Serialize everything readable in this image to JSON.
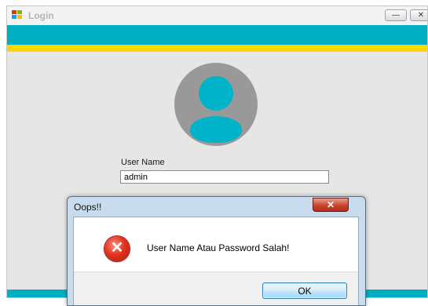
{
  "window": {
    "title": "Login",
    "minimize_glyph": "—",
    "close_glyph": "✕"
  },
  "form": {
    "username_label": "User Name",
    "username_value": "admin"
  },
  "dialog": {
    "title": "Oops!!",
    "close_glyph": "✕",
    "icon": "error-icon",
    "icon_glyph": "✕",
    "message": "User Name Atau Password Salah!",
    "ok_label": "OK"
  },
  "colors": {
    "brand_teal": "#00afc2",
    "accent_yellow": "#ffd400",
    "avatar_gray": "#999999",
    "avatar_teal": "#00b3c9",
    "error_red": "#e3341f"
  }
}
